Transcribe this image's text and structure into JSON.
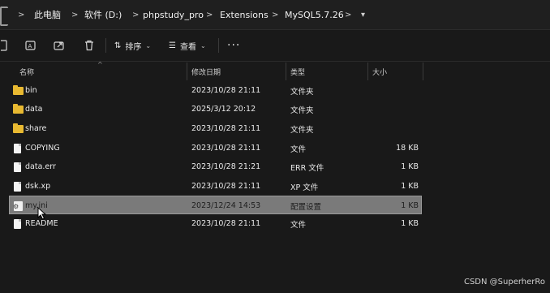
{
  "breadcrumb": {
    "items": [
      "此电脑",
      "软件 (D:)",
      "phpstudy_pro",
      "Extensions",
      "MySQL5.7.26"
    ],
    "separator": ">",
    "overflow_chevron": "▾"
  },
  "toolbar": {
    "sort_label": "排序",
    "view_label": "查看",
    "more_label": "···",
    "icons": [
      "new-item-icon",
      "rename-icon",
      "share-icon",
      "delete-icon"
    ]
  },
  "columns": {
    "name": "名称",
    "modified": "修改日期",
    "type": "类型",
    "size": "大小"
  },
  "files": [
    {
      "name": "bin",
      "modified": "2023/10/28 21:11",
      "type": "文件夹",
      "size": "",
      "icon": "folder-icon",
      "selected": false
    },
    {
      "name": "data",
      "modified": "2025/3/12 20:12",
      "type": "文件夹",
      "size": "",
      "icon": "folder-icon",
      "selected": false
    },
    {
      "name": "share",
      "modified": "2023/10/28 21:11",
      "type": "文件夹",
      "size": "",
      "icon": "folder-icon",
      "selected": false
    },
    {
      "name": "COPYING",
      "modified": "2023/10/28 21:11",
      "type": "文件",
      "size": "18 KB",
      "icon": "file-icon",
      "selected": false
    },
    {
      "name": "data.err",
      "modified": "2023/10/28 21:21",
      "type": "ERR 文件",
      "size": "1 KB",
      "icon": "file-icon",
      "selected": false
    },
    {
      "name": "dsk.xp",
      "modified": "2023/10/28 21:11",
      "type": "XP 文件",
      "size": "1 KB",
      "icon": "file-icon",
      "selected": false
    },
    {
      "name": "my.ini",
      "modified": "2023/12/24 14:53",
      "type": "配置设置",
      "size": "1 KB",
      "icon": "settings-file-icon",
      "selected": true
    },
    {
      "name": "README",
      "modified": "2023/10/28 21:11",
      "type": "文件",
      "size": "1 KB",
      "icon": "file-icon",
      "selected": false
    }
  ],
  "watermark": "CSDN @SuperherRo",
  "colors": {
    "background": "#191919",
    "selection": "#7a7a7a",
    "folder": "#e8b931"
  }
}
